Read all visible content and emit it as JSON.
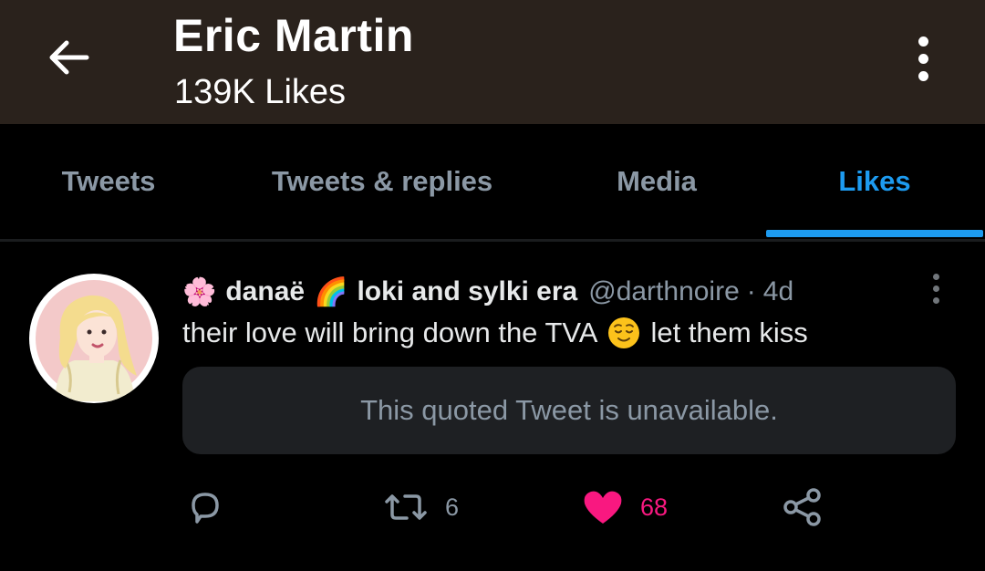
{
  "header": {
    "title": "Eric Martin",
    "subtitle": "139K Likes",
    "back_icon": "arrow-left-icon",
    "more_icon": "more-vertical-icon"
  },
  "tabs": [
    {
      "label": "Tweets",
      "active": false
    },
    {
      "label": "Tweets & replies",
      "active": false
    },
    {
      "label": "Media",
      "active": false
    },
    {
      "label": "Likes",
      "active": true
    }
  ],
  "colors": {
    "accent": "#1d9bf0",
    "like": "#f91880",
    "header_bg": "#2a221c",
    "secondary_text": "#8b98a5"
  },
  "tweet": {
    "name_emoji_prefix": "🌸",
    "name_part1": "danaë",
    "name_emoji_mid": "🌈",
    "name_part2": "loki and sylki era",
    "handle": "@darthnoire",
    "separator": "·",
    "time": "4d",
    "text_before": "their love will bring down the TVA",
    "text_emoji": "relieved-face-emoji",
    "text_after": "let them kiss",
    "quote_unavailable": "This quoted Tweet is unavailable.",
    "replies": "",
    "retweets": "6",
    "likes": "68",
    "liked": true
  }
}
